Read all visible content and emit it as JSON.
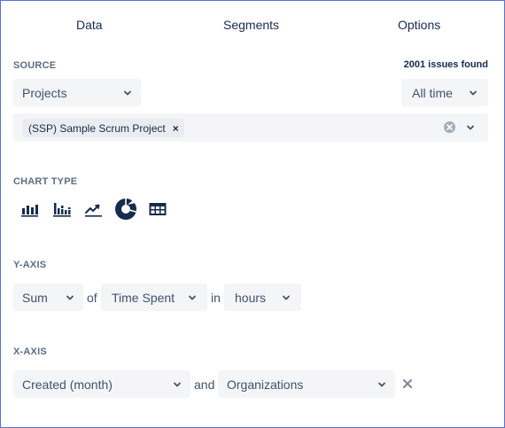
{
  "tabs": [
    "Data",
    "Segments",
    "Options"
  ],
  "source": {
    "label": "SOURCE",
    "issues_found": "2001 issues found",
    "source_type": "Projects",
    "time_range": "All time",
    "selected_tag": "(SSP) Sample Scrum Project",
    "tag_remove": "×"
  },
  "chart_type": {
    "label": "CHART TYPE",
    "icons": [
      "bar-chart-icon",
      "stacked-bar-chart-icon",
      "line-chart-icon",
      "donut-chart-icon",
      "table-icon"
    ],
    "selected": "donut-chart-icon"
  },
  "y_axis": {
    "label": "Y-AXIS",
    "aggregation": "Sum",
    "of_text": "of",
    "field": "Time Spent",
    "in_text": "in",
    "unit": "hours"
  },
  "x_axis": {
    "label": "X-AXIS",
    "field": "Created (month)",
    "and_text": "and",
    "second_field": "Organizations"
  },
  "colors": {
    "accent": "#172b4d",
    "field_bg": "#f4f5f7",
    "label": "#5e6c84"
  }
}
